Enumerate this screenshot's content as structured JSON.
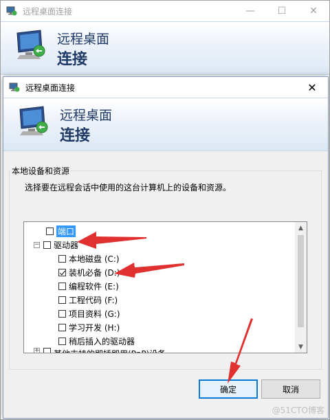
{
  "window": {
    "title": "远程桌面连接",
    "banner_line1": "远程桌面",
    "banner_line2": "连接"
  },
  "dialog": {
    "title": "远程桌面连接",
    "banner_line1": "远程桌面",
    "banner_line2": "连接",
    "group_title": "本地设备和资源",
    "description": "选择要在远程会话中使用的这台计算机上的设备和资源。",
    "tree": {
      "port_label": "端口",
      "drives_label": "驱动器",
      "drives": [
        {
          "label": "本地磁盘 (C:)",
          "checked": false
        },
        {
          "label": "装机必备 (D:)",
          "checked": true
        },
        {
          "label": "编程软件 (E:)",
          "checked": false
        },
        {
          "label": "工程代码 (F:)",
          "checked": false
        },
        {
          "label": "项目资料 (G:)",
          "checked": false
        },
        {
          "label": "学习开发 (H:)",
          "checked": false
        },
        {
          "label": "稍后插入的驱动器",
          "checked": false
        }
      ],
      "partial_label": "其他支持的即插即用(PnP)设备"
    },
    "ok_label": "确定",
    "cancel_label": "取消",
    "close_glyph": "✕"
  },
  "watermark": "@51CTO博客",
  "icons": {
    "app": "remote-desktop-icon",
    "monitor": "remote-desktop-monitor-icon"
  },
  "colors": {
    "banner_text": "#1f3a66",
    "selection": "#3399ff",
    "annotation_arrow": "#e03030",
    "ok_border": "#0078d7"
  }
}
